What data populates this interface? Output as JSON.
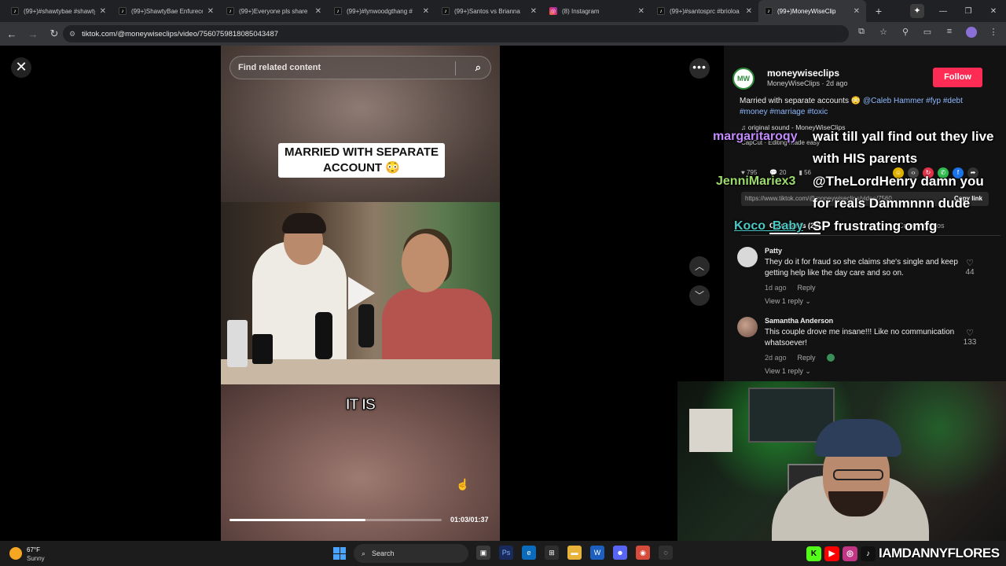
{
  "browser": {
    "tabs": [
      {
        "label": "(99+)#shawtybae #shawtyba",
        "icon": "tiktok-icon"
      },
      {
        "label": "(99+)ShawtyBae Enfurece",
        "icon": "tiktok-icon"
      },
      {
        "label": "(99+)Everyone pls share",
        "icon": "tiktok-icon"
      },
      {
        "label": "(99+)#lynwoodgthang #",
        "icon": "tiktok-icon"
      },
      {
        "label": "(99+)Santos vs Brianna",
        "icon": "tiktok-icon"
      },
      {
        "label": "(8) Instagram",
        "icon": "instagram-icon"
      },
      {
        "label": "(99+)#santosprc #brioloa",
        "icon": "tiktok-icon"
      },
      {
        "label": "(99+)MoneyWiseClip",
        "icon": "tiktok-icon",
        "active": true
      }
    ],
    "url": "tiktok.com/@moneywiseclips/video/7560759818085043487"
  },
  "video": {
    "search_placeholder": "Find related content",
    "caption_top": "MARRIED WITH SEPARATE ACCOUNT 😳",
    "caption_bottom": "IT IS",
    "progress": 0.64,
    "timecode": "01:03/01:37"
  },
  "author": {
    "avatar_text": "MW",
    "username": "moneywiseclips",
    "subtitle": "MoneyWiseClips · 2d ago",
    "follow_label": "Follow",
    "description": "Married with separate accounts 😳",
    "tags": "@Caleb Hammer #fyp #debt #money #marriage #toxic",
    "sound": "♫ original sound - MoneyWiseClips",
    "capcut": "CapCut · Editing made easy",
    "likes": "795",
    "comments": "20",
    "saves": "56",
    "link": "https://www.tiktok.com/@moneywiseclips/video/7560...",
    "copy_label": "Copy link",
    "tab_comments": "Comments (20)",
    "tab_creator": "Creator videos"
  },
  "comments": [
    {
      "name": "Patty",
      "text": "They do it for fraud so she claims she's single and keep getting help like the day care and so on.",
      "time": "1d ago",
      "reply": "Reply",
      "view": "View 1 reply ⌄",
      "likes": "44"
    },
    {
      "name": "Samantha Anderson",
      "text": "This couple drove me insane!!! Like no communication whatsoever!",
      "time": "2d ago",
      "reply": "Reply",
      "view": "View 1 reply ⌄",
      "likes": "133"
    }
  ],
  "chat": [
    {
      "user": "margaritaroqy",
      "msg": "wait till yall find out they live with HIS parents"
    },
    {
      "user": "JenniMariex3",
      "msg": "@TheLordHenry damn you for reals Dammnnn dude"
    },
    {
      "user": "Koco_Baby",
      "msg": "SP frustrating omfg"
    }
  ],
  "overlay": {
    "handle": "IAMDANNYFLORES"
  },
  "taskbar": {
    "temp": "67°F",
    "condition": "Sunny",
    "search": "Search"
  },
  "colors": {
    "follow": "#fe2c55",
    "chat_user1": "#c38bff",
    "chat_user2": "#9cdc6b",
    "chat_user3": "#4cc8c4"
  }
}
